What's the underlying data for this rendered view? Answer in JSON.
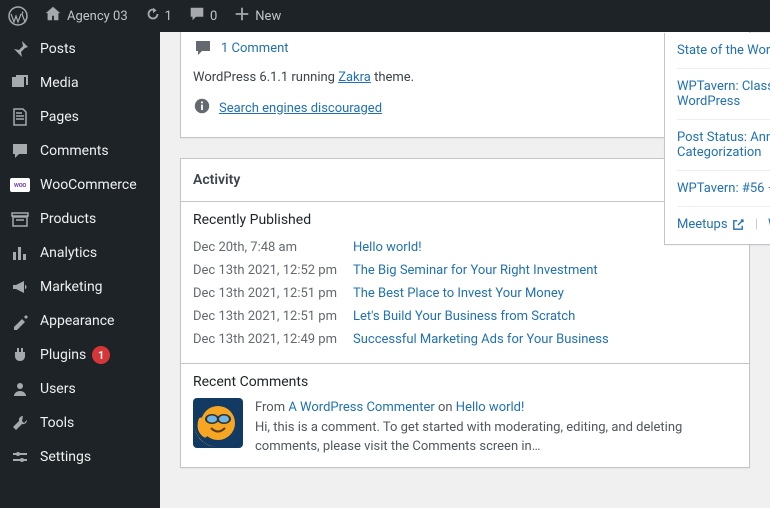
{
  "admin_bar": {
    "site_name": "Agency 03",
    "updates_count": "1",
    "comments_count": "0",
    "new_label": "New"
  },
  "sidebar": {
    "items": [
      {
        "label": "Posts"
      },
      {
        "label": "Media"
      },
      {
        "label": "Pages"
      },
      {
        "label": "Comments"
      },
      {
        "label": "WooCommerce"
      },
      {
        "label": "Products"
      },
      {
        "label": "Analytics"
      },
      {
        "label": "Marketing"
      },
      {
        "label": "Appearance"
      },
      {
        "label": "Plugins",
        "badge": "1"
      },
      {
        "label": "Users"
      },
      {
        "label": "Tools"
      },
      {
        "label": "Settings"
      }
    ]
  },
  "at_a_glance": {
    "comments_link": "1 Comment",
    "version_prefix": "WordPress 6.1.1 running ",
    "theme_name": "Zakra",
    "version_suffix": " theme.",
    "seo_warning": "Search engines discouraged"
  },
  "activity": {
    "title": "Activity",
    "recently_published_title": "Recently Published",
    "posts": [
      {
        "date": "Dec 20th, 7:48 am",
        "title": "Hello world!"
      },
      {
        "date": "Dec 13th 2021, 12:52 pm",
        "title": "The Big Seminar for Your Right Investment"
      },
      {
        "date": "Dec 13th 2021, 12:51 pm",
        "title": "The Best Place to Invest Your Money"
      },
      {
        "date": "Dec 13th 2021, 12:51 pm",
        "title": "Let's Build Your Business from Scratch"
      },
      {
        "date": "Dec 13th 2021, 12:49 pm",
        "title": "Successful Marketing Ads for Your Business"
      }
    ],
    "recent_comments_title": "Recent Comments",
    "comment": {
      "from_label": "From ",
      "author": "A WordPress Commenter",
      "on_label": " on ",
      "post": "Hello world!",
      "body": "Hi, this is a comment. To get started with moderating, editing, and deleting comments, please visit the Comments screen in…"
    }
  },
  "news": {
    "items": [
      "State of the Word",
      "WPTavern: Classic WordPress",
      "Post Status: Annual Categorization",
      "WPTavern: #56 –"
    ],
    "footer_meetups": "Meetups",
    "footer_w": "W"
  }
}
